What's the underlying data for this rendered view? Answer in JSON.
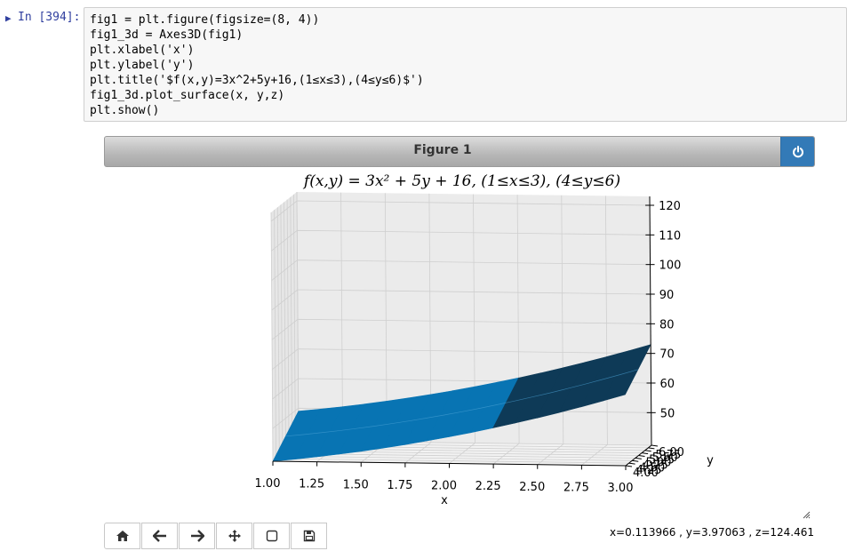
{
  "cell": {
    "toggle": "▶",
    "prompt": "In [394]:",
    "code_lines": [
      "fig1 = plt.figure(figsize=(8, 4))",
      "fig1_3d = Axes3D(fig1)",
      "plt.xlabel('x')",
      "plt.ylabel('y')",
      "plt.title('$f(x,y)=3x^2+5y+16,(1≤x≤3),(4≤y≤6)$')",
      "fig1_3d.plot_surface(x, y,z)",
      "plt.show()"
    ]
  },
  "figure": {
    "title": "Figure 1",
    "close_icon": "power-icon",
    "accent": "#337ab7"
  },
  "chart_data": {
    "type": "surface3d",
    "title": "f(x,y) = 3x² + 5y + 16, (1≤x≤3), (4≤y≤6)",
    "xlabel": "x",
    "ylabel": "y",
    "x_ticks": [
      "1.00",
      "1.25",
      "1.50",
      "1.75",
      "2.00",
      "2.25",
      "2.50",
      "2.75",
      "3.00"
    ],
    "y_ticks": [
      "4.00",
      "4.25",
      "4.50",
      "4.75",
      "5.00",
      "5.25",
      "5.50",
      "5.75",
      "6.00"
    ],
    "z_ticks": [
      "50",
      "60",
      "70",
      "80",
      "90",
      "100",
      "110",
      "120"
    ],
    "xlim": [
      1,
      3
    ],
    "ylim": [
      4,
      6
    ],
    "zlim": [
      39,
      123
    ],
    "surface_color": "#1f77b4",
    "grid": true
  },
  "toolbar": {
    "buttons": [
      {
        "name": "home",
        "icon": "home-icon"
      },
      {
        "name": "back",
        "icon": "arrow-left-icon"
      },
      {
        "name": "forward",
        "icon": "arrow-right-icon"
      },
      {
        "name": "pan",
        "icon": "move-icon"
      },
      {
        "name": "zoom",
        "icon": "square-icon"
      },
      {
        "name": "save",
        "icon": "floppy-icon"
      }
    ],
    "readout": "x=0.113966 , y=3.97063 , z=124.461"
  }
}
